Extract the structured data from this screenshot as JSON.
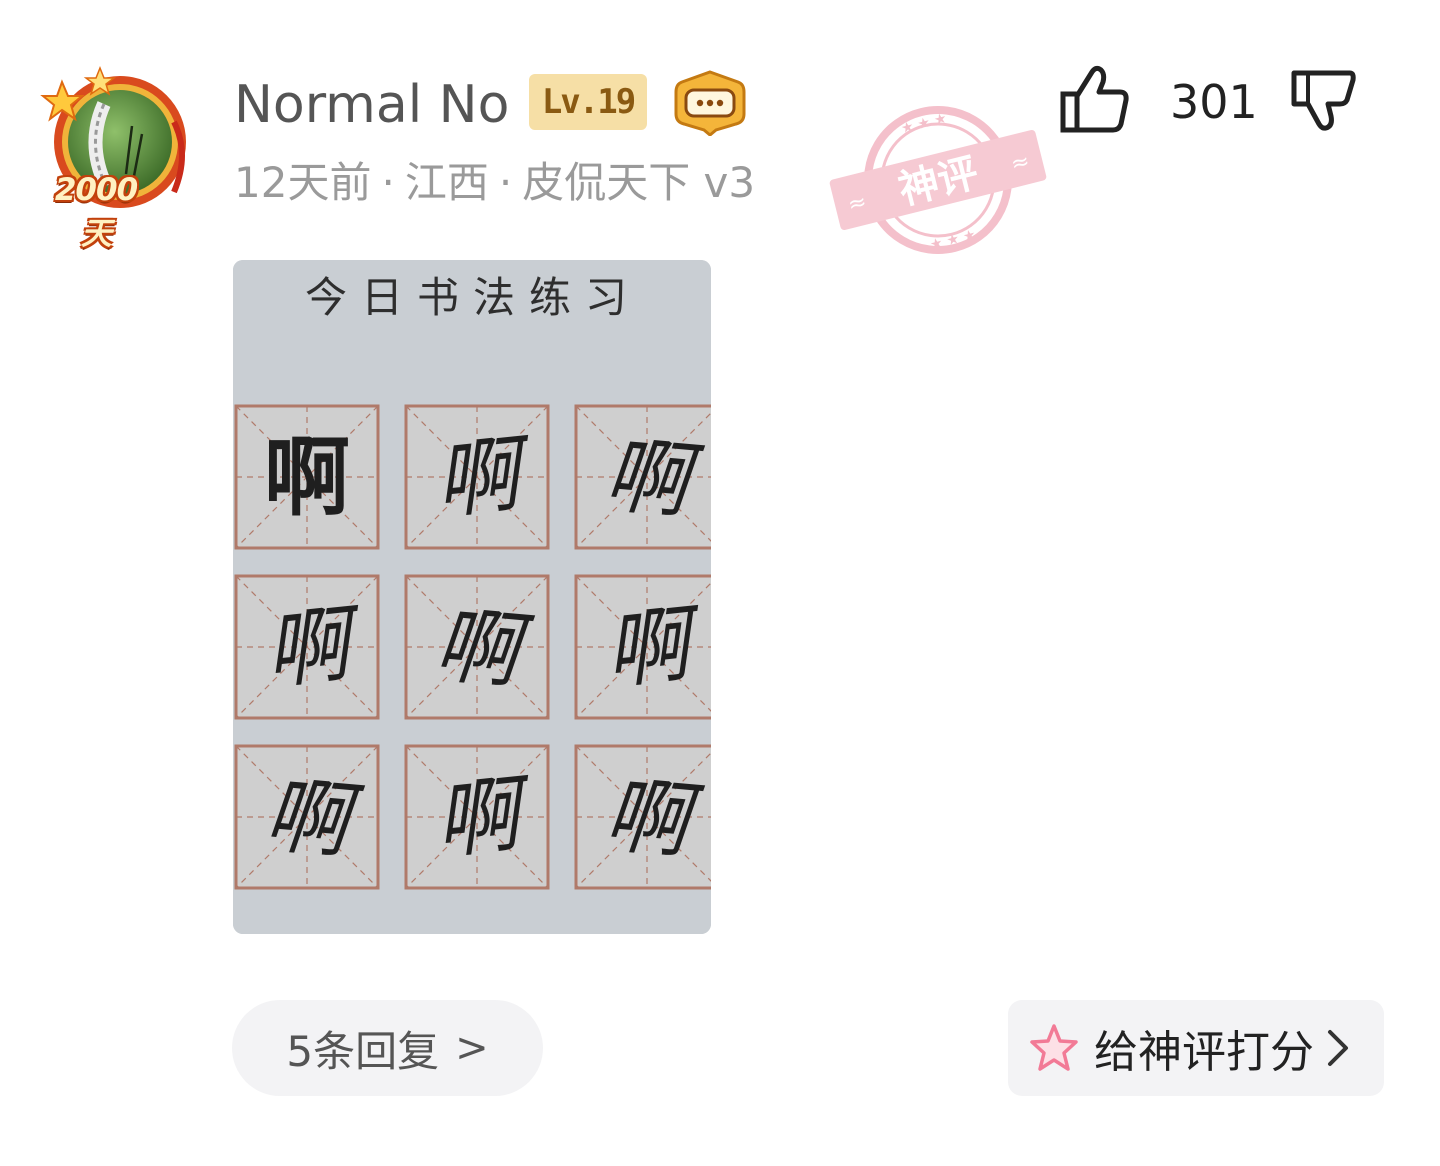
{
  "comment": {
    "avatar": {
      "icon": "avatar-icon",
      "days_badge": "2000天"
    },
    "username": "Normal No",
    "level": "Lv.19",
    "chat_badge_icon": "chat-bubble-icon",
    "meta": {
      "time": "12天前",
      "location": "江西",
      "device": "皮侃天下 v3",
      "separator": "·"
    },
    "stamp": {
      "text": "神评",
      "color": "#f3b6c2"
    },
    "votes": {
      "like_icon": "thumbs-up-icon",
      "like_count": "301",
      "dislike_icon": "thumbs-down-icon"
    },
    "image": {
      "title": "今日书法练习",
      "cells": [
        "啊",
        "啊",
        "啊",
        "啊",
        "啊",
        "啊",
        "啊",
        "啊",
        "啊"
      ]
    },
    "replies_button": {
      "label": "5条回复",
      "chevron": ">"
    },
    "rate_button": {
      "icon": "star-icon",
      "label": "给神评打分",
      "chevron_icon": "chevron-right-icon"
    }
  },
  "colors": {
    "level_badge_bg": "#f6dfa6",
    "level_badge_text": "#8a5a12",
    "meta_text": "#9a9a9a",
    "button_bg": "#f3f3f5",
    "stamp_pink": "#f3b6c2"
  }
}
